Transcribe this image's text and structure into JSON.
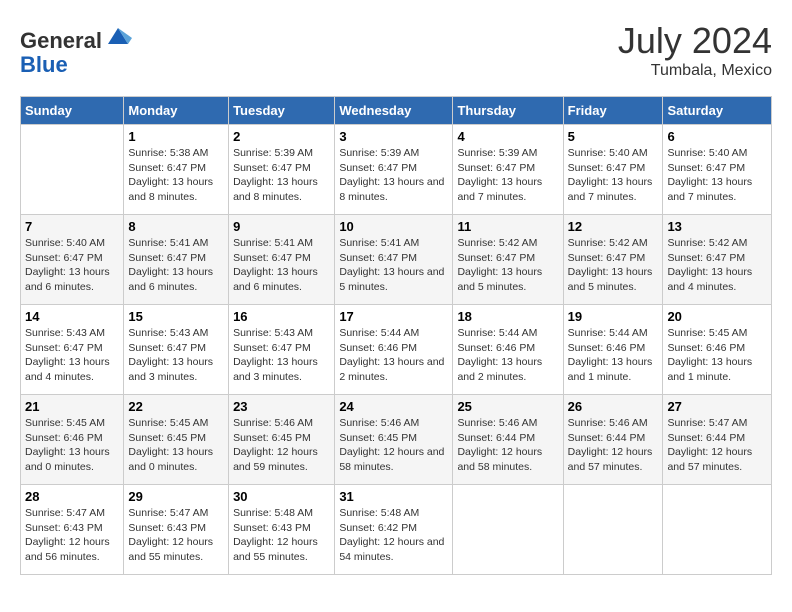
{
  "header": {
    "logo_general": "General",
    "logo_blue": "Blue",
    "month": "July 2024",
    "location": "Tumbala, Mexico"
  },
  "days_of_week": [
    "Sunday",
    "Monday",
    "Tuesday",
    "Wednesday",
    "Thursday",
    "Friday",
    "Saturday"
  ],
  "weeks": [
    [
      {
        "day": "",
        "info": ""
      },
      {
        "day": "1",
        "info": "Sunrise: 5:38 AM\nSunset: 6:47 PM\nDaylight: 13 hours and 8 minutes."
      },
      {
        "day": "2",
        "info": "Sunrise: 5:39 AM\nSunset: 6:47 PM\nDaylight: 13 hours and 8 minutes."
      },
      {
        "day": "3",
        "info": "Sunrise: 5:39 AM\nSunset: 6:47 PM\nDaylight: 13 hours and 8 minutes."
      },
      {
        "day": "4",
        "info": "Sunrise: 5:39 AM\nSunset: 6:47 PM\nDaylight: 13 hours and 7 minutes."
      },
      {
        "day": "5",
        "info": "Sunrise: 5:40 AM\nSunset: 6:47 PM\nDaylight: 13 hours and 7 minutes."
      },
      {
        "day": "6",
        "info": "Sunrise: 5:40 AM\nSunset: 6:47 PM\nDaylight: 13 hours and 7 minutes."
      }
    ],
    [
      {
        "day": "7",
        "info": "Sunrise: 5:40 AM\nSunset: 6:47 PM\nDaylight: 13 hours and 6 minutes."
      },
      {
        "day": "8",
        "info": "Sunrise: 5:41 AM\nSunset: 6:47 PM\nDaylight: 13 hours and 6 minutes."
      },
      {
        "day": "9",
        "info": "Sunrise: 5:41 AM\nSunset: 6:47 PM\nDaylight: 13 hours and 6 minutes."
      },
      {
        "day": "10",
        "info": "Sunrise: 5:41 AM\nSunset: 6:47 PM\nDaylight: 13 hours and 5 minutes."
      },
      {
        "day": "11",
        "info": "Sunrise: 5:42 AM\nSunset: 6:47 PM\nDaylight: 13 hours and 5 minutes."
      },
      {
        "day": "12",
        "info": "Sunrise: 5:42 AM\nSunset: 6:47 PM\nDaylight: 13 hours and 5 minutes."
      },
      {
        "day": "13",
        "info": "Sunrise: 5:42 AM\nSunset: 6:47 PM\nDaylight: 13 hours and 4 minutes."
      }
    ],
    [
      {
        "day": "14",
        "info": "Sunrise: 5:43 AM\nSunset: 6:47 PM\nDaylight: 13 hours and 4 minutes."
      },
      {
        "day": "15",
        "info": "Sunrise: 5:43 AM\nSunset: 6:47 PM\nDaylight: 13 hours and 3 minutes."
      },
      {
        "day": "16",
        "info": "Sunrise: 5:43 AM\nSunset: 6:47 PM\nDaylight: 13 hours and 3 minutes."
      },
      {
        "day": "17",
        "info": "Sunrise: 5:44 AM\nSunset: 6:46 PM\nDaylight: 13 hours and 2 minutes."
      },
      {
        "day": "18",
        "info": "Sunrise: 5:44 AM\nSunset: 6:46 PM\nDaylight: 13 hours and 2 minutes."
      },
      {
        "day": "19",
        "info": "Sunrise: 5:44 AM\nSunset: 6:46 PM\nDaylight: 13 hours and 1 minute."
      },
      {
        "day": "20",
        "info": "Sunrise: 5:45 AM\nSunset: 6:46 PM\nDaylight: 13 hours and 1 minute."
      }
    ],
    [
      {
        "day": "21",
        "info": "Sunrise: 5:45 AM\nSunset: 6:46 PM\nDaylight: 13 hours and 0 minutes."
      },
      {
        "day": "22",
        "info": "Sunrise: 5:45 AM\nSunset: 6:45 PM\nDaylight: 13 hours and 0 minutes."
      },
      {
        "day": "23",
        "info": "Sunrise: 5:46 AM\nSunset: 6:45 PM\nDaylight: 12 hours and 59 minutes."
      },
      {
        "day": "24",
        "info": "Sunrise: 5:46 AM\nSunset: 6:45 PM\nDaylight: 12 hours and 58 minutes."
      },
      {
        "day": "25",
        "info": "Sunrise: 5:46 AM\nSunset: 6:44 PM\nDaylight: 12 hours and 58 minutes."
      },
      {
        "day": "26",
        "info": "Sunrise: 5:46 AM\nSunset: 6:44 PM\nDaylight: 12 hours and 57 minutes."
      },
      {
        "day": "27",
        "info": "Sunrise: 5:47 AM\nSunset: 6:44 PM\nDaylight: 12 hours and 57 minutes."
      }
    ],
    [
      {
        "day": "28",
        "info": "Sunrise: 5:47 AM\nSunset: 6:43 PM\nDaylight: 12 hours and 56 minutes."
      },
      {
        "day": "29",
        "info": "Sunrise: 5:47 AM\nSunset: 6:43 PM\nDaylight: 12 hours and 55 minutes."
      },
      {
        "day": "30",
        "info": "Sunrise: 5:48 AM\nSunset: 6:43 PM\nDaylight: 12 hours and 55 minutes."
      },
      {
        "day": "31",
        "info": "Sunrise: 5:48 AM\nSunset: 6:42 PM\nDaylight: 12 hours and 54 minutes."
      },
      {
        "day": "",
        "info": ""
      },
      {
        "day": "",
        "info": ""
      },
      {
        "day": "",
        "info": ""
      }
    ]
  ]
}
